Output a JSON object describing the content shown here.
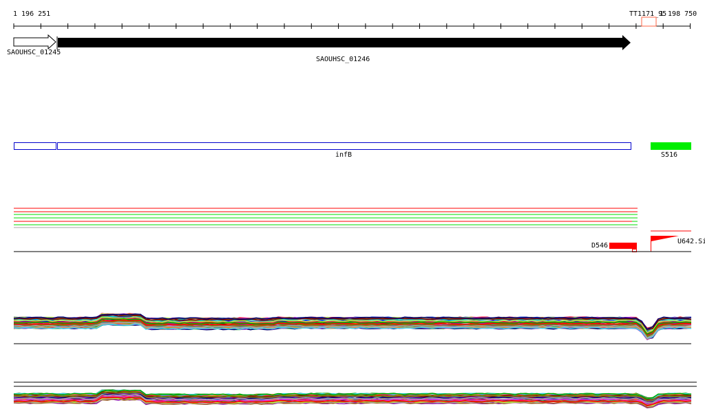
{
  "ruler": {
    "start_label": "1 196 251",
    "end_label": "1 198 750",
    "marker_label": "TT1171_95"
  },
  "genes": [
    {
      "name": "SAOUHSC_01245",
      "style": "outline"
    },
    {
      "name": "SAOUHSC_01246",
      "style": "filled"
    }
  ],
  "features": [
    {
      "name": "infB",
      "color": "#0000cc"
    },
    {
      "name": "S516",
      "color": "#00ee00"
    }
  ],
  "signals": {
    "left_label": "D546",
    "right_label": "U642.Si",
    "color": "#ff0000"
  },
  "colors": {
    "red": "#ff0000",
    "green": "#00dd00",
    "marker": "#ff6644"
  }
}
